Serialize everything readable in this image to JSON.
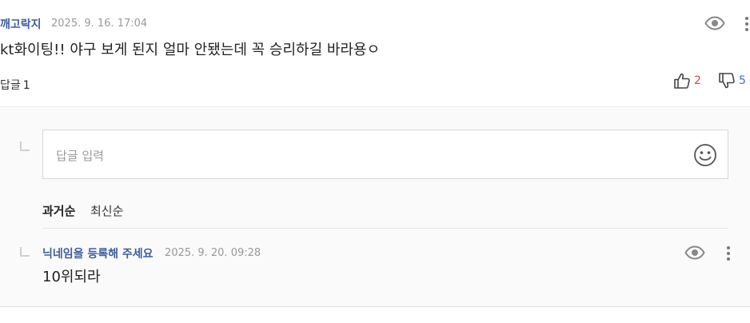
{
  "comment": {
    "nickname": "깨고락지",
    "date": "2025. 9. 16. 17:04",
    "text": "kt화이팅!! 야구 보게 된지 얼마 안됐는데 꼭 승리하길 바라용ㅇ",
    "reply_label": "답글",
    "reply_count": "1",
    "like_count": "2",
    "dislike_count": "5",
    "icons": {
      "view": "eye-icon",
      "more": "more-vertical-icon",
      "like": "thumbs-up-icon",
      "dislike": "thumbs-down-icon"
    }
  },
  "reply_form": {
    "placeholder": "답글 입력",
    "value": "",
    "icon": "emoji-smile-icon"
  },
  "sort": {
    "options": [
      "과거순",
      "최신순"
    ],
    "selected": "과거순"
  },
  "replies": [
    {
      "nickname": "닉네임을 등록해 주세요",
      "date": "2025. 9. 20. 09:28",
      "text": "10위되라"
    }
  ],
  "colors": {
    "nickname": "#3e5e9e",
    "like": "#e0403f",
    "dislike": "#3e6fc9",
    "reply_bg": "#fafafa"
  }
}
